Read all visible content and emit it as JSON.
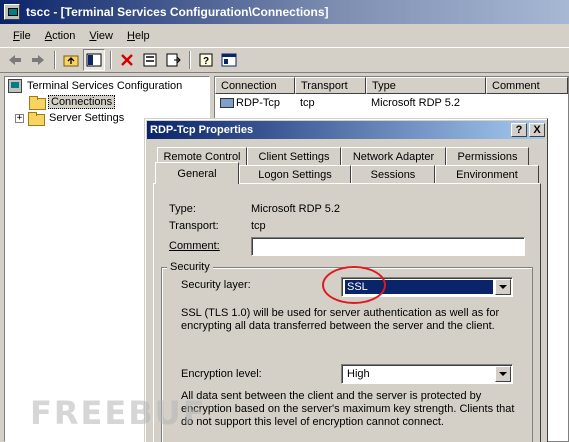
{
  "window": {
    "title": "tscc - [Terminal Services Configuration\\Connections]"
  },
  "menu": [
    {
      "label": "File",
      "u": "F",
      "rest": "ile"
    },
    {
      "label": "Action",
      "u": "A",
      "rest": "ction"
    },
    {
      "label": "View",
      "u": "V",
      "rest": "iew"
    },
    {
      "label": "Help",
      "u": "H",
      "rest": "elp"
    }
  ],
  "toolbar": {
    "icons": [
      "back-arrow-icon",
      "forward-arrow-icon",
      "up-folder-icon",
      "show-hide-tree-icon",
      "delete-icon",
      "properties-icon",
      "export-list-icon",
      "help-icon",
      "console-icon"
    ]
  },
  "tree": {
    "root_label": "Terminal Services Configuration",
    "connections_label": "Connections",
    "server_settings_label": "Server Settings"
  },
  "list": {
    "columns": [
      "Connection",
      "Transport",
      "Type",
      "Comment"
    ],
    "rows": [
      {
        "connection": "RDP-Tcp",
        "transport": "tcp",
        "type": "Microsoft RDP 5.2",
        "comment": ""
      }
    ]
  },
  "dialog": {
    "title": "RDP-Tcp Properties",
    "help_button": "?",
    "close_button": "X",
    "tabs_row1": [
      "Remote Control",
      "Client Settings",
      "Network Adapter",
      "Permissions"
    ],
    "tabs_row2": [
      "General",
      "Logon Settings",
      "Sessions",
      "Environment"
    ],
    "active_tab": "General",
    "type_label": "Type:",
    "type_value": "Microsoft RDP 5.2",
    "transport_label": "Transport:",
    "transport_value": "tcp",
    "comment_label": "Comment:",
    "comment_value": "",
    "security_group": "Security",
    "security_layer_label": "Security layer:",
    "security_layer_value": "SSL",
    "security_layer_desc": "SSL (TLS 1.0) will be used for server authentication as well as for encrypting all data transferred between the server and the client.",
    "encryption_label": "Encryption level:",
    "encryption_value": "High",
    "encryption_desc": "All data sent between the client and the server is protected by encryption based on the server's maximum key strength. Clients that do not support this level of encryption cannot connect."
  },
  "watermark": {
    "text": "FREEBUF"
  },
  "colors": {
    "titlebar": "#0a246a",
    "annotation": "#e0191f",
    "face": "#d4d0c8"
  }
}
